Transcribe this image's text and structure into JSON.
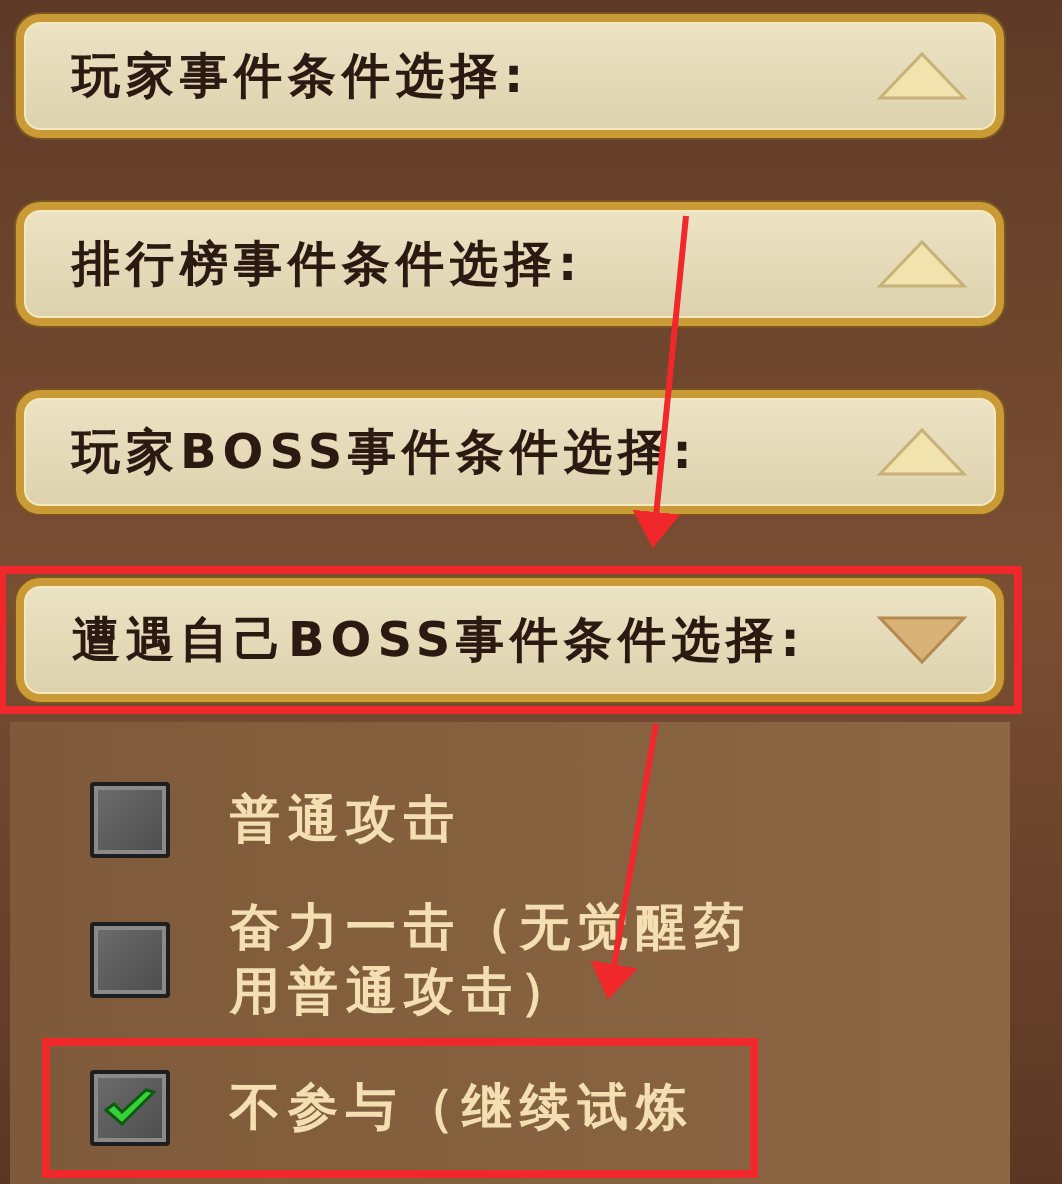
{
  "sections": [
    {
      "title": "玩家事件条件选择:",
      "expanded": false,
      "highlighted": false
    },
    {
      "title": "排行榜事件条件选择:",
      "expanded": false,
      "highlighted": false
    },
    {
      "title": "玩家BOSS事件条件选择:",
      "expanded": false,
      "highlighted": false
    },
    {
      "title": "遭遇自己BOSS事件条件选择:",
      "expanded": true,
      "highlighted": true,
      "options": [
        {
          "lines": [
            "普通攻击"
          ],
          "checked": false,
          "highlighted": false
        },
        {
          "lines": [
            "奋力一击（无觉醒药",
            "用普通攻击）"
          ],
          "checked": false,
          "highlighted": false
        },
        {
          "lines": [
            "不参与（继续试炼"
          ],
          "checked": true,
          "highlighted": true
        }
      ]
    }
  ]
}
